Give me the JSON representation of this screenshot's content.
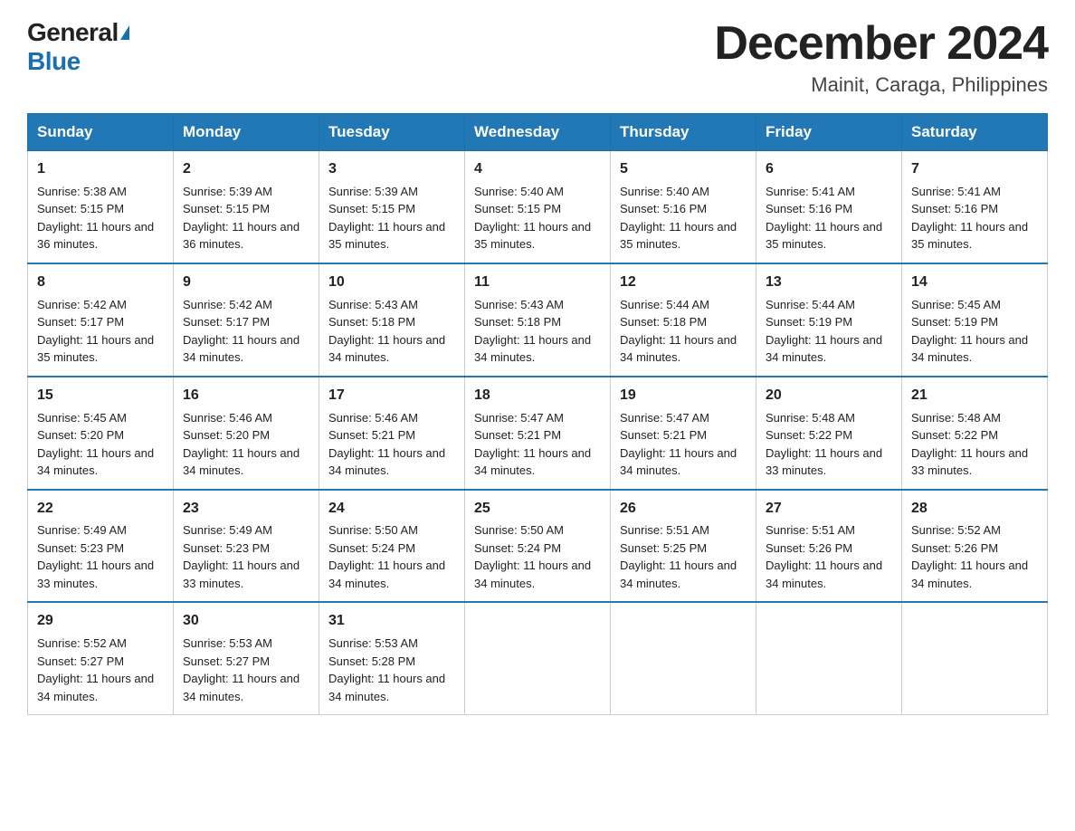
{
  "header": {
    "logo_general": "General",
    "logo_blue": "Blue",
    "month_title": "December 2024",
    "location": "Mainit, Caraga, Philippines"
  },
  "weekdays": [
    "Sunday",
    "Monday",
    "Tuesday",
    "Wednesday",
    "Thursday",
    "Friday",
    "Saturday"
  ],
  "weeks": [
    [
      {
        "day": "1",
        "sunrise": "5:38 AM",
        "sunset": "5:15 PM",
        "daylight": "11 hours and 36 minutes."
      },
      {
        "day": "2",
        "sunrise": "5:39 AM",
        "sunset": "5:15 PM",
        "daylight": "11 hours and 36 minutes."
      },
      {
        "day": "3",
        "sunrise": "5:39 AM",
        "sunset": "5:15 PM",
        "daylight": "11 hours and 35 minutes."
      },
      {
        "day": "4",
        "sunrise": "5:40 AM",
        "sunset": "5:15 PM",
        "daylight": "11 hours and 35 minutes."
      },
      {
        "day": "5",
        "sunrise": "5:40 AM",
        "sunset": "5:16 PM",
        "daylight": "11 hours and 35 minutes."
      },
      {
        "day": "6",
        "sunrise": "5:41 AM",
        "sunset": "5:16 PM",
        "daylight": "11 hours and 35 minutes."
      },
      {
        "day": "7",
        "sunrise": "5:41 AM",
        "sunset": "5:16 PM",
        "daylight": "11 hours and 35 minutes."
      }
    ],
    [
      {
        "day": "8",
        "sunrise": "5:42 AM",
        "sunset": "5:17 PM",
        "daylight": "11 hours and 35 minutes."
      },
      {
        "day": "9",
        "sunrise": "5:42 AM",
        "sunset": "5:17 PM",
        "daylight": "11 hours and 34 minutes."
      },
      {
        "day": "10",
        "sunrise": "5:43 AM",
        "sunset": "5:18 PM",
        "daylight": "11 hours and 34 minutes."
      },
      {
        "day": "11",
        "sunrise": "5:43 AM",
        "sunset": "5:18 PM",
        "daylight": "11 hours and 34 minutes."
      },
      {
        "day": "12",
        "sunrise": "5:44 AM",
        "sunset": "5:18 PM",
        "daylight": "11 hours and 34 minutes."
      },
      {
        "day": "13",
        "sunrise": "5:44 AM",
        "sunset": "5:19 PM",
        "daylight": "11 hours and 34 minutes."
      },
      {
        "day": "14",
        "sunrise": "5:45 AM",
        "sunset": "5:19 PM",
        "daylight": "11 hours and 34 minutes."
      }
    ],
    [
      {
        "day": "15",
        "sunrise": "5:45 AM",
        "sunset": "5:20 PM",
        "daylight": "11 hours and 34 minutes."
      },
      {
        "day": "16",
        "sunrise": "5:46 AM",
        "sunset": "5:20 PM",
        "daylight": "11 hours and 34 minutes."
      },
      {
        "day": "17",
        "sunrise": "5:46 AM",
        "sunset": "5:21 PM",
        "daylight": "11 hours and 34 minutes."
      },
      {
        "day": "18",
        "sunrise": "5:47 AM",
        "sunset": "5:21 PM",
        "daylight": "11 hours and 34 minutes."
      },
      {
        "day": "19",
        "sunrise": "5:47 AM",
        "sunset": "5:21 PM",
        "daylight": "11 hours and 34 minutes."
      },
      {
        "day": "20",
        "sunrise": "5:48 AM",
        "sunset": "5:22 PM",
        "daylight": "11 hours and 33 minutes."
      },
      {
        "day": "21",
        "sunrise": "5:48 AM",
        "sunset": "5:22 PM",
        "daylight": "11 hours and 33 minutes."
      }
    ],
    [
      {
        "day": "22",
        "sunrise": "5:49 AM",
        "sunset": "5:23 PM",
        "daylight": "11 hours and 33 minutes."
      },
      {
        "day": "23",
        "sunrise": "5:49 AM",
        "sunset": "5:23 PM",
        "daylight": "11 hours and 33 minutes."
      },
      {
        "day": "24",
        "sunrise": "5:50 AM",
        "sunset": "5:24 PM",
        "daylight": "11 hours and 34 minutes."
      },
      {
        "day": "25",
        "sunrise": "5:50 AM",
        "sunset": "5:24 PM",
        "daylight": "11 hours and 34 minutes."
      },
      {
        "day": "26",
        "sunrise": "5:51 AM",
        "sunset": "5:25 PM",
        "daylight": "11 hours and 34 minutes."
      },
      {
        "day": "27",
        "sunrise": "5:51 AM",
        "sunset": "5:26 PM",
        "daylight": "11 hours and 34 minutes."
      },
      {
        "day": "28",
        "sunrise": "5:52 AM",
        "sunset": "5:26 PM",
        "daylight": "11 hours and 34 minutes."
      }
    ],
    [
      {
        "day": "29",
        "sunrise": "5:52 AM",
        "sunset": "5:27 PM",
        "daylight": "11 hours and 34 minutes."
      },
      {
        "day": "30",
        "sunrise": "5:53 AM",
        "sunset": "5:27 PM",
        "daylight": "11 hours and 34 minutes."
      },
      {
        "day": "31",
        "sunrise": "5:53 AM",
        "sunset": "5:28 PM",
        "daylight": "11 hours and 34 minutes."
      },
      null,
      null,
      null,
      null
    ]
  ],
  "labels": {
    "sunrise_prefix": "Sunrise: ",
    "sunset_prefix": "Sunset: ",
    "daylight_prefix": "Daylight: "
  }
}
